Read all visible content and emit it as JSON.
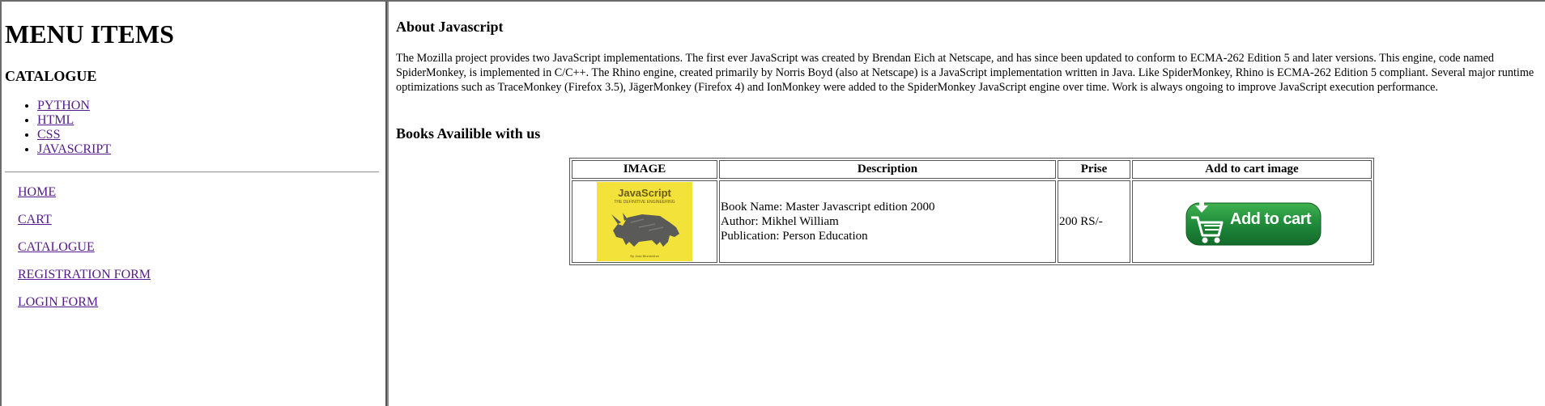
{
  "sidebar": {
    "title": "MENU ITEMS",
    "catalogue_title": "CATALOGUE",
    "catalogue_links": [
      "PYTHON",
      "HTML",
      "CSS",
      "JAVASCRIPT"
    ],
    "nav_links": [
      "HOME",
      "CART",
      "CATALOGUE",
      "REGISTRATION FORM",
      "LOGIN FORM"
    ],
    "link_color": "#551a8b"
  },
  "main": {
    "about_title": "About Javascript",
    "about_text": "The Mozilla project provides two JavaScript implementations. The first ever JavaScript was created by Brendan Eich at Netscape, and has since been updated to conform to ECMA-262 Edition 5 and later versions. This engine, code named SpiderMonkey, is implemented in C/C++. The Rhino engine, created primarily by Norris Boyd (also at Netscape) is a JavaScript implementation written in Java. Like SpiderMonkey, Rhino is ECMA-262 Edition 5 compliant. Several major runtime optimizations such as TraceMonkey (Firefox 3.5), JägerMonkey (Firefox 4) and IonMonkey were added to the SpiderMonkey JavaScript engine over time. Work is always ongoing to improve JavaScript execution performance.",
    "books_title": "Books Availible with us",
    "table": {
      "headers": [
        "IMAGE",
        "Description",
        "Prise",
        "Add to cart image"
      ],
      "rows": [
        {
          "cover": {
            "title": "JavaScript",
            "subtitle": "THE DEFINITIVE ENGINEERING",
            "footer": "By Jose Blumenthal",
            "bg_color": "#f2e23a"
          },
          "description": [
            "Book Name: Master Javascript edition 2000",
            "Author: Mikhel William",
            "Publication: Person Education"
          ],
          "price": "200 RS/-",
          "cart_button": {
            "label": "Add to cart",
            "color": "#1f8a3a",
            "icon": "cart-icon"
          }
        }
      ]
    }
  }
}
